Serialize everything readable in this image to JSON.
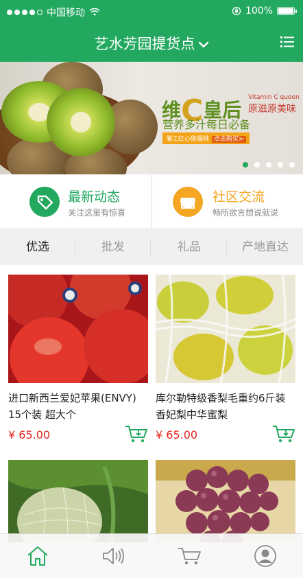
{
  "status": {
    "carrier": "中国移动",
    "battery": "100%",
    "battery_level": 1.0
  },
  "header": {
    "title": "艺水芳园提货点"
  },
  "banner": {
    "headline_pre": "维",
    "headline_c": "C",
    "headline_post": "皇后",
    "en": "Vitamin C queen",
    "headline2": "原滋原美味",
    "sub": "营养多汁每日必备",
    "tag": "蒲江红心猕猴桃",
    "tag_action": "点击购买>",
    "pages": 5,
    "active_page": 1
  },
  "quick": [
    {
      "title": "最新动态",
      "subtitle": "关注这里有惊喜",
      "color": "#22a85f",
      "icon": "tag-icon"
    },
    {
      "title": "社区交流",
      "subtitle": "畅所欲言想说就说",
      "color": "#f5a623",
      "icon": "shop-icon"
    }
  ],
  "tabs": [
    "优选",
    "批发",
    "礼品",
    "产地直达"
  ],
  "products": [
    {
      "name": "进口新西兰爱妃苹果(ENVY) 15个装 超大个",
      "price": "¥ 65.00",
      "image": "apples"
    },
    {
      "name": "库尔勒特级香梨毛重约6斤装 香妃梨中华蜜梨",
      "price": "¥ 65.00",
      "image": "pears"
    },
    {
      "name": "",
      "price": "",
      "image": "melon"
    },
    {
      "name": "",
      "price": "",
      "image": "grapes"
    }
  ],
  "nav": [
    "home-icon",
    "speaker-icon",
    "cart-icon",
    "user-icon"
  ],
  "colors": {
    "brand": "#22a85f",
    "price": "#e4241d",
    "accent": "#f5a623"
  }
}
